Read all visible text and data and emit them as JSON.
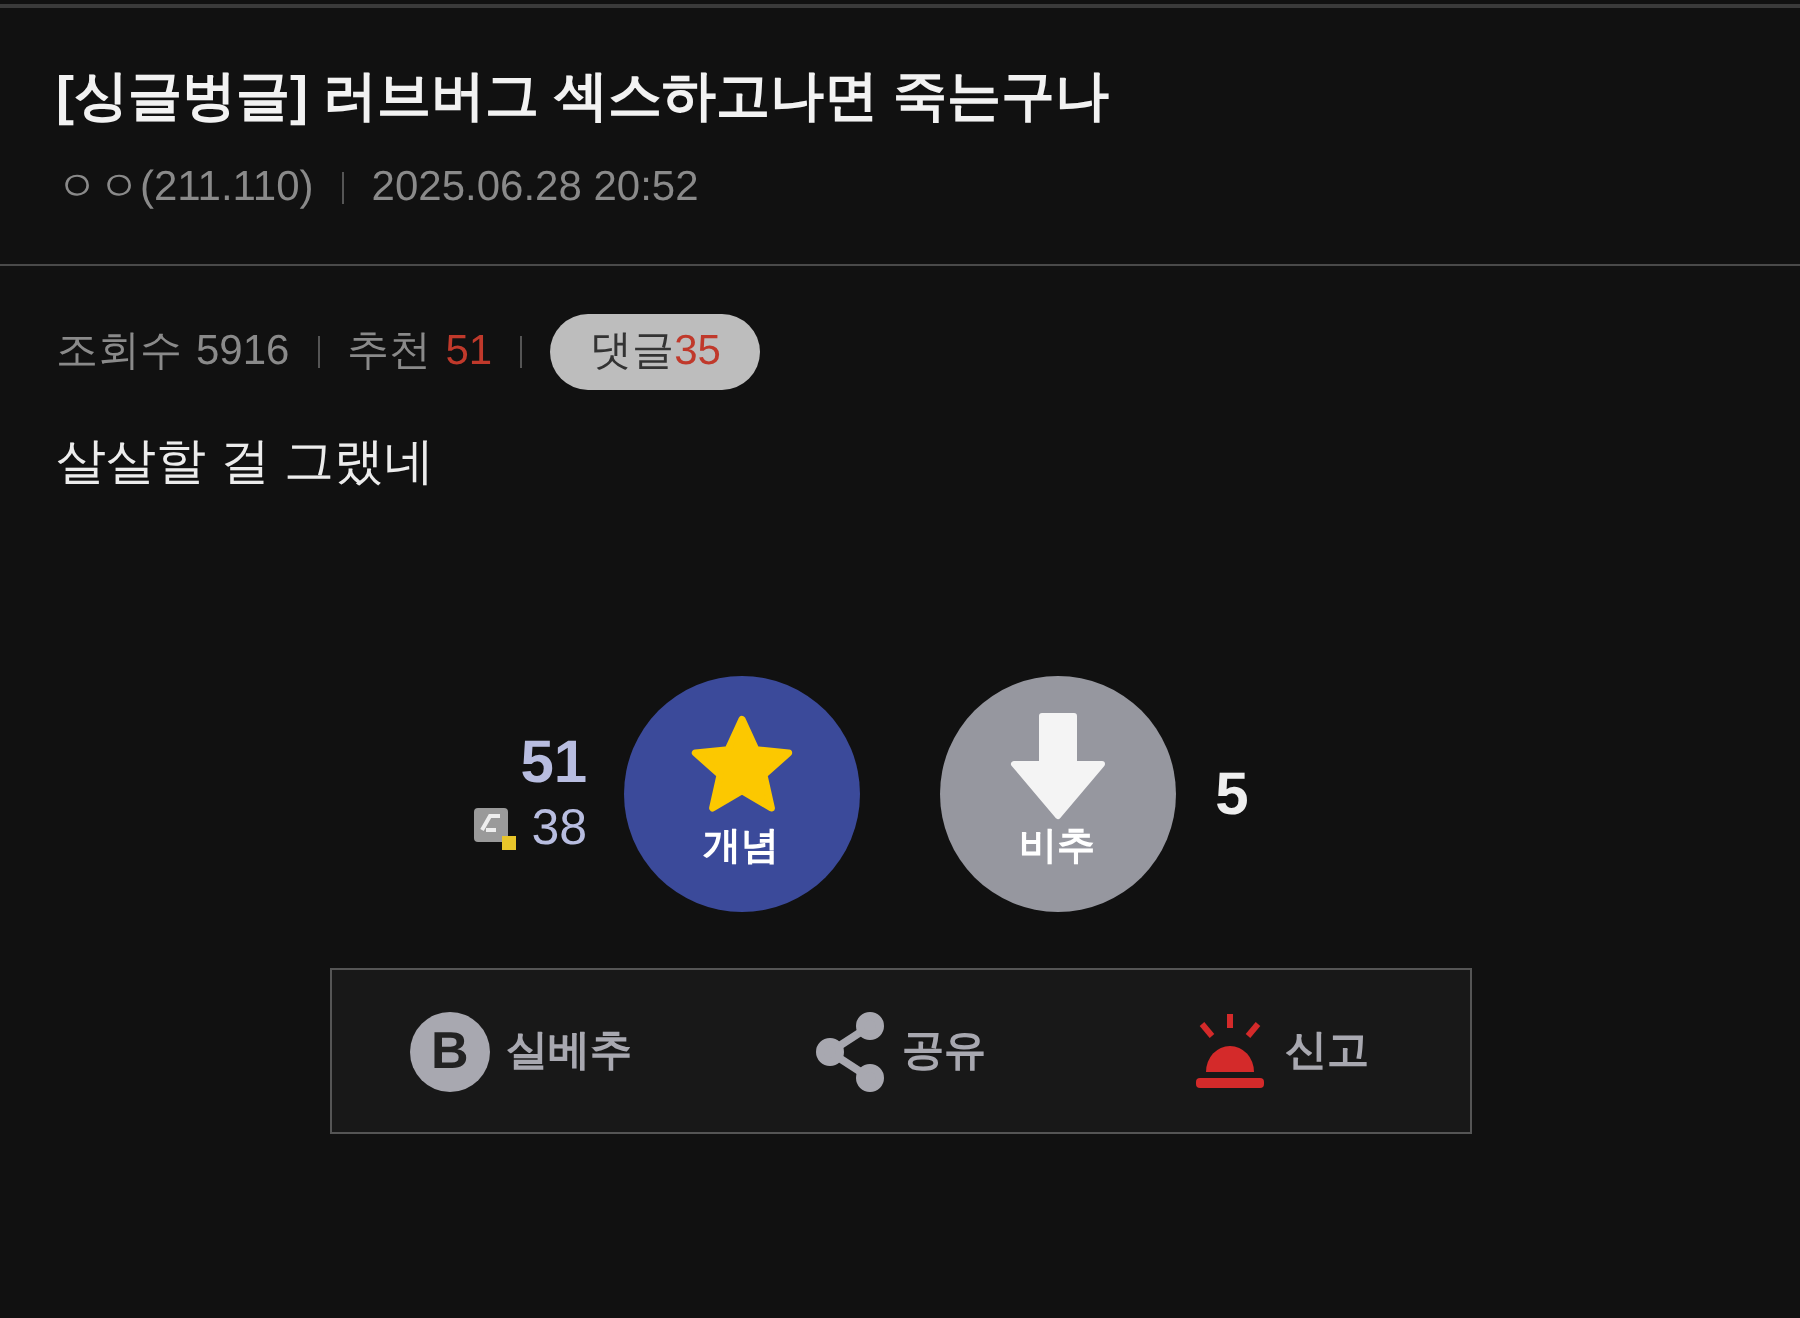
{
  "post": {
    "title": "[싱글벙글] 러브버그 섹스하고나면 죽는구나",
    "author": "ㅇㅇ(211.110)",
    "date": "2025.06.28 20:52"
  },
  "stats": {
    "views_label": "조회수",
    "views": "5916",
    "recommend_label": "추천",
    "recommend": "51",
    "comments_label": "댓글",
    "comments": "35"
  },
  "body": "살살할 걸 그랬네",
  "votes": {
    "up_total": "51",
    "up_fixed": "38",
    "up_label": "개념",
    "down_label": "비추",
    "down_count": "5"
  },
  "actions": [
    {
      "kind": "best",
      "icon_text": "B",
      "label": "실베추"
    },
    {
      "kind": "share",
      "label": "공유"
    },
    {
      "kind": "report",
      "label": "신고"
    }
  ]
}
